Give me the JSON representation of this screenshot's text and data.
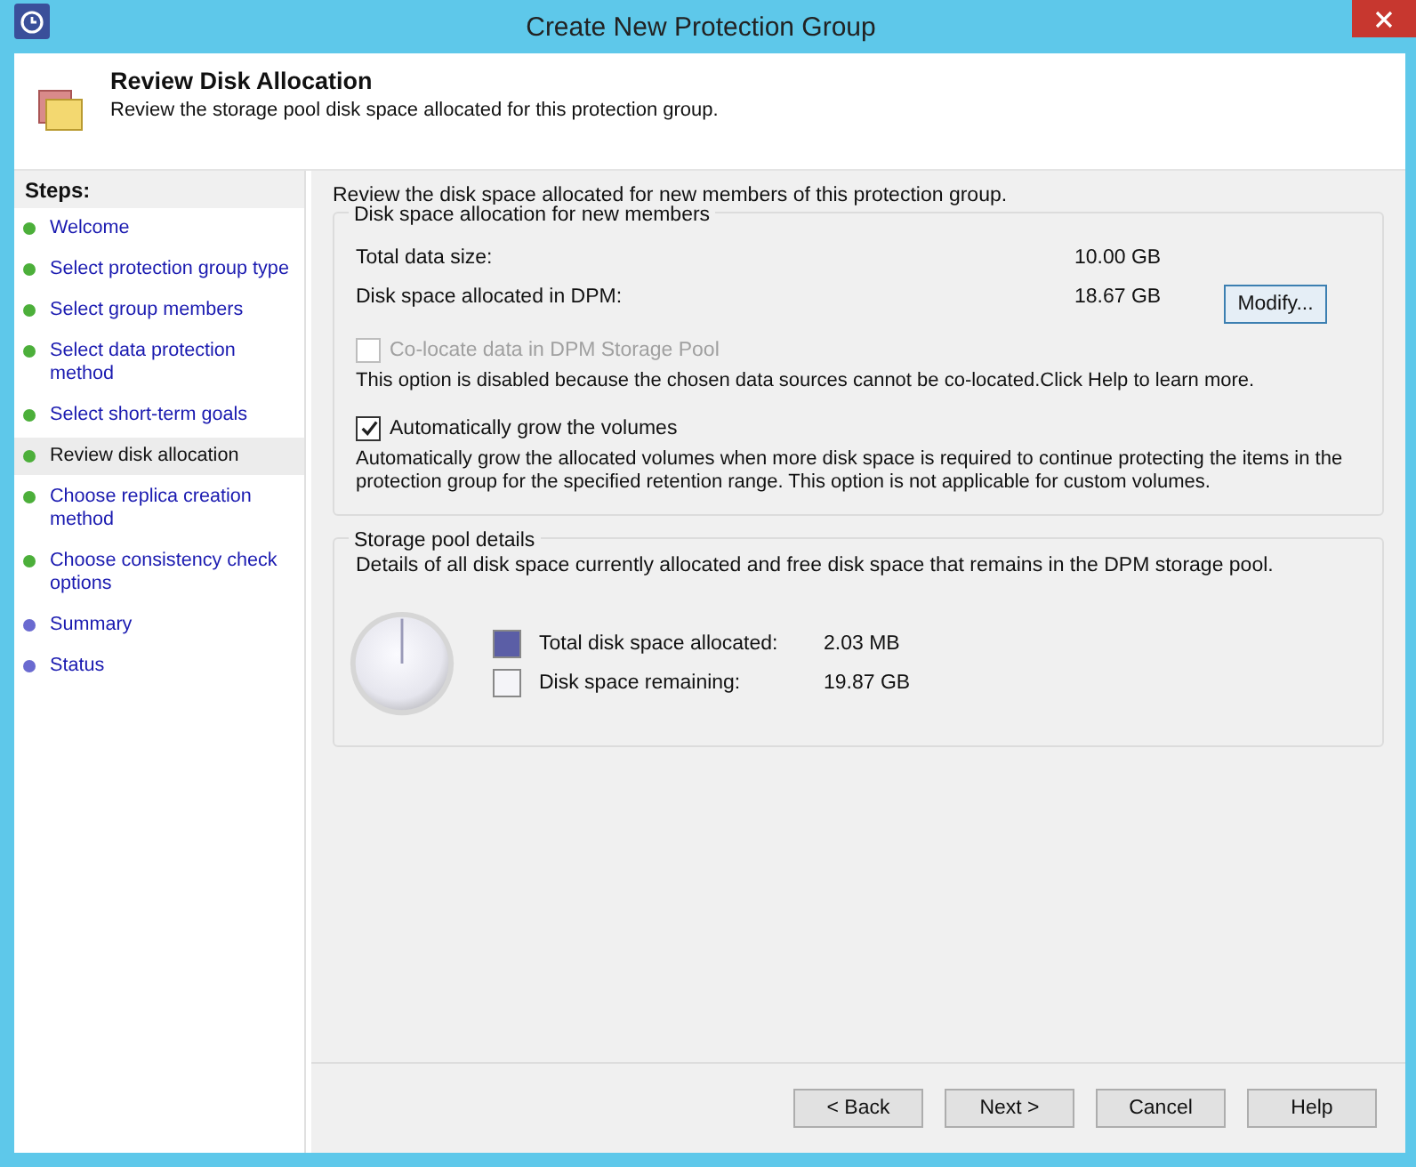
{
  "window": {
    "title": "Create New Protection Group"
  },
  "header": {
    "title": "Review Disk Allocation",
    "subtitle": "Review the storage pool disk space allocated for this protection group."
  },
  "steps": {
    "heading": "Steps:",
    "items": [
      {
        "label": "Welcome",
        "selected": false,
        "color": "#4caf3a"
      },
      {
        "label": "Select protection group type",
        "selected": false,
        "color": "#4caf3a"
      },
      {
        "label": "Select group members",
        "selected": false,
        "color": "#4caf3a"
      },
      {
        "label": "Select data protection method",
        "selected": false,
        "color": "#4caf3a"
      },
      {
        "label": "Select short-term goals",
        "selected": false,
        "color": "#4caf3a"
      },
      {
        "label": "Review disk allocation",
        "selected": true,
        "color": "#4caf3a"
      },
      {
        "label": "Choose replica creation method",
        "selected": false,
        "color": "#4caf3a"
      },
      {
        "label": "Choose consistency check options",
        "selected": false,
        "color": "#4caf3a"
      },
      {
        "label": "Summary",
        "selected": false,
        "color": "#6a6ad0"
      },
      {
        "label": "Status",
        "selected": false,
        "color": "#6a6ad0"
      }
    ]
  },
  "intro": "Review the disk space allocated for new members of this protection group.",
  "allocation": {
    "legend": "Disk space allocation for new members",
    "rows": [
      {
        "label": "Total data size:",
        "value": "10.00 GB"
      },
      {
        "label": "Disk space allocated in DPM:",
        "value": "18.67 GB",
        "button": "Modify..."
      }
    ],
    "options": [
      {
        "label": "Co-locate data in DPM Storage Pool",
        "checked": false,
        "disabled": true,
        "note": "This option is disabled because the chosen data sources cannot be co-located.Click Help to learn more."
      },
      {
        "label": "Automatically grow the volumes",
        "checked": true,
        "disabled": false,
        "note": "Automatically grow the allocated volumes when more disk space is required to continue protecting the items in the protection group for the specified retention range. This option is not applicable for custom volumes."
      }
    ]
  },
  "storage": {
    "legend": "Storage pool details",
    "description": "Details of all disk space currently allocated and free disk space that remains in the DPM storage pool.",
    "legend_items": [
      {
        "label": "Total disk space allocated:",
        "value": "2.03 MB",
        "color": "#5b5ea6"
      },
      {
        "label": "Disk space remaining:",
        "value": "19.87 GB",
        "color": "#f4f4f8"
      }
    ]
  },
  "buttons": [
    "< Back",
    "Next >",
    "Cancel",
    "Help"
  ]
}
